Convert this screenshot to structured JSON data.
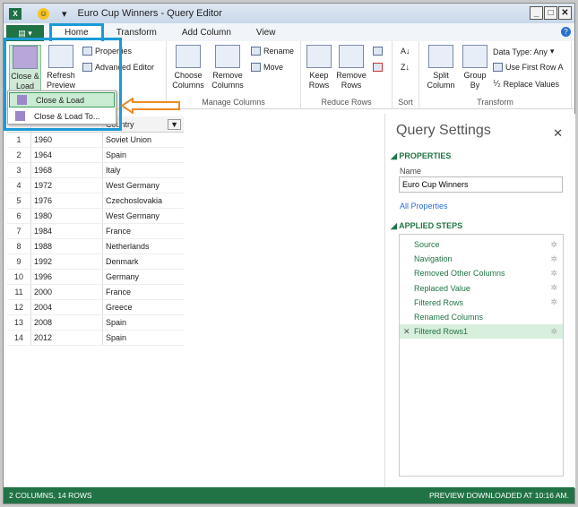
{
  "window": {
    "title": "Euro Cup Winners - Query Editor"
  },
  "tabs": [
    {
      "label": "Home"
    },
    {
      "label": "Transform"
    },
    {
      "label": "Add Column"
    },
    {
      "label": "View"
    }
  ],
  "ribbon": {
    "close_load": "Close &",
    "close_load2": "Load",
    "refresh": "Refresh",
    "refresh2": "Preview",
    "properties": "Properties",
    "advanced_editor": "Advanced Editor",
    "choose": "Choose",
    "choose2": "Columns",
    "remove": "Remove",
    "remove2": "Columns",
    "rename": "Rename",
    "move": "Move",
    "manage_columns": "Manage Columns",
    "keep": "Keep",
    "keep2": "Rows",
    "remove_rows": "Remove",
    "remove_rows2": "Rows",
    "reduce_rows": "Reduce Rows",
    "sort": "Sort",
    "split": "Split",
    "split2": "Column",
    "group": "Group",
    "group2": "By",
    "data_type": "Data Type: Any",
    "first_row": "Use First Row A",
    "replace_values": "Replace Values",
    "transform": "Transform"
  },
  "menu": {
    "items": [
      {
        "label": "Close & Load"
      },
      {
        "label": "Close & Load To..."
      }
    ]
  },
  "grid": {
    "header": [
      "",
      "Country"
    ],
    "rows": [
      [
        "1",
        "1960",
        "Soviet Union"
      ],
      [
        "2",
        "1964",
        "Spain"
      ],
      [
        "3",
        "1968",
        "Italy"
      ],
      [
        "4",
        "1972",
        "West Germany"
      ],
      [
        "5",
        "1976",
        "Czechoslovakia"
      ],
      [
        "6",
        "1980",
        "West Germany"
      ],
      [
        "7",
        "1984",
        "France"
      ],
      [
        "8",
        "1988",
        "Netherlands"
      ],
      [
        "9",
        "1992",
        "Denmark"
      ],
      [
        "10",
        "1996",
        "Germany"
      ],
      [
        "11",
        "2000",
        "France"
      ],
      [
        "12",
        "2004",
        "Greece"
      ],
      [
        "13",
        "2008",
        "Spain"
      ],
      [
        "14",
        "2012",
        "Spain"
      ]
    ]
  },
  "settings": {
    "title": "Query Settings",
    "properties": "PROPERTIES",
    "name_label": "Name",
    "name_value": "Euro Cup Winners",
    "all_properties": "All Properties",
    "applied_steps": "APPLIED STEPS",
    "steps": [
      {
        "label": "Source"
      },
      {
        "label": "Navigation"
      },
      {
        "label": "Removed Other Columns"
      },
      {
        "label": "Replaced Value"
      },
      {
        "label": "Filtered Rows"
      },
      {
        "label": "Renamed Columns"
      },
      {
        "label": "Filtered Rows1"
      }
    ]
  },
  "status": {
    "left": "2 COLUMNS, 14 ROWS",
    "right": "PREVIEW DOWNLOADED AT 10:16 AM."
  },
  "colors": {
    "accent": "#217346",
    "highlight": "#1a9bd7",
    "arrow": "#f08a24"
  }
}
